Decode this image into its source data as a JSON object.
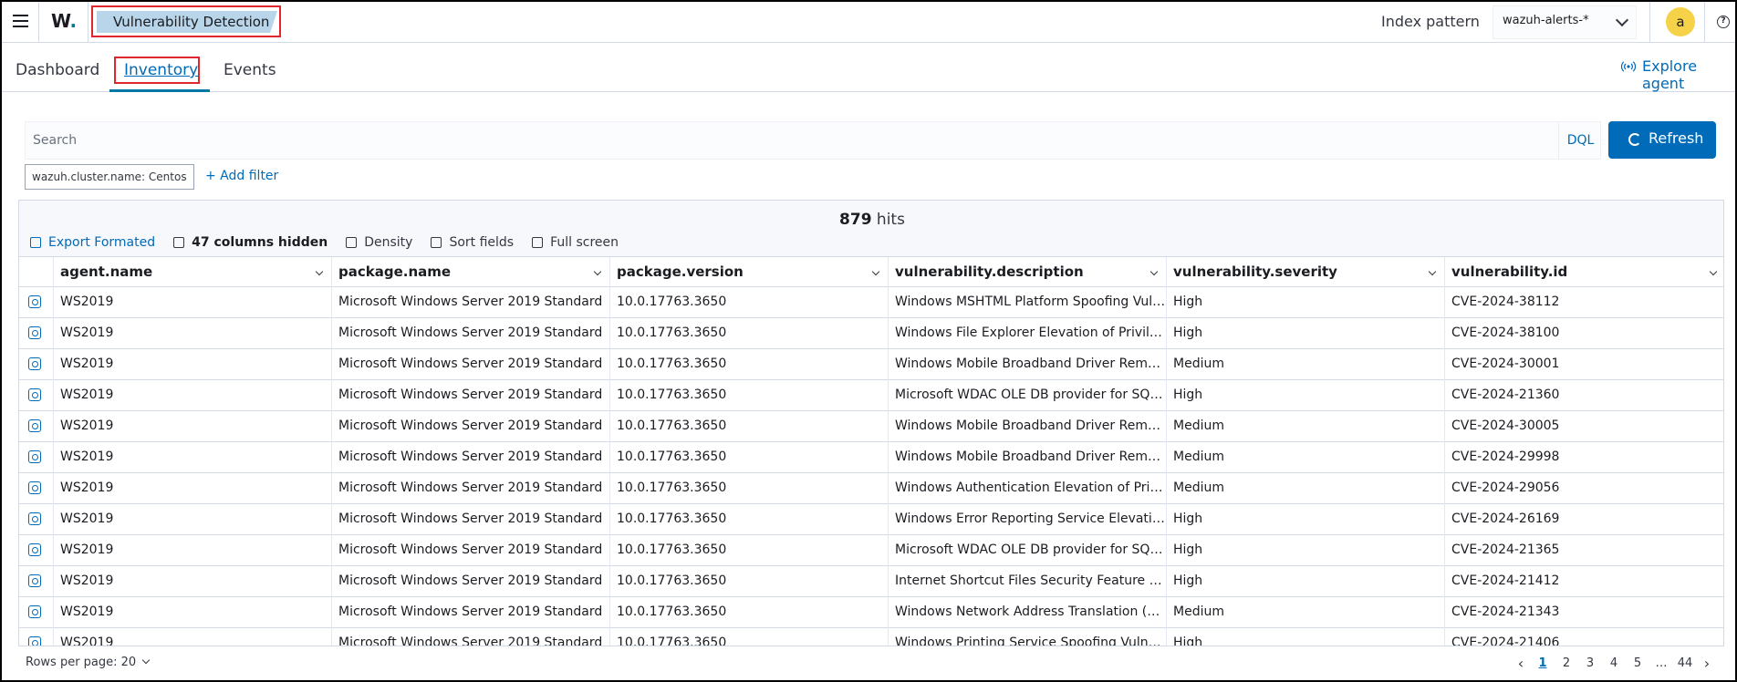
{
  "header": {
    "logo_text": "W",
    "logo_dot": ".",
    "breadcrumb": "Vulnerability Detection",
    "index_pattern_label": "Index pattern",
    "index_pattern_value": "wazuh-alerts-*",
    "avatar_initial": "a",
    "help_glyph": "?"
  },
  "tabs": [
    {
      "label": "Dashboard"
    },
    {
      "label": "Inventory"
    },
    {
      "label": "Events"
    }
  ],
  "explore_agent": "Explore agent",
  "search": {
    "placeholder": "Search",
    "query_language": "DQL",
    "refresh_label": "Refresh"
  },
  "filters": [
    {
      "label": "wazuh.cluster.name: Centos"
    }
  ],
  "add_filter_label": "+ Add filter",
  "grid": {
    "hits_count": "879",
    "hits_label": " hits",
    "toolbar": {
      "export": "Export Formated",
      "columns_hidden": "47 columns hidden",
      "density": "Density",
      "sort": "Sort fields",
      "fullscreen": "Full screen"
    },
    "columns": [
      "agent.name",
      "package.name",
      "package.version",
      "vulnerability.description",
      "vulnerability.severity",
      "vulnerability.id"
    ],
    "rows": [
      [
        "WS2019",
        "Microsoft Windows Server 2019 Standard",
        "10.0.17763.3650",
        "Windows MSHTML Platform Spoofing Vulnerability",
        "High",
        "CVE-2024-38112"
      ],
      [
        "WS2019",
        "Microsoft Windows Server 2019 Standard",
        "10.0.17763.3650",
        "Windows File Explorer Elevation of Privilege Vulnerability",
        "High",
        "CVE-2024-38100"
      ],
      [
        "WS2019",
        "Microsoft Windows Server 2019 Standard",
        "10.0.17763.3650",
        "Windows Mobile Broadband Driver Remote Code Execution",
        "Medium",
        "CVE-2024-30001"
      ],
      [
        "WS2019",
        "Microsoft Windows Server 2019 Standard",
        "10.0.17763.3650",
        "Microsoft WDAC OLE DB provider for SQL Server",
        "High",
        "CVE-2024-21360"
      ],
      [
        "WS2019",
        "Microsoft Windows Server 2019 Standard",
        "10.0.17763.3650",
        "Windows Mobile Broadband Driver Remote Code Execution",
        "Medium",
        "CVE-2024-30005"
      ],
      [
        "WS2019",
        "Microsoft Windows Server 2019 Standard",
        "10.0.17763.3650",
        "Windows Mobile Broadband Driver Remote Code Execution",
        "Medium",
        "CVE-2024-29998"
      ],
      [
        "WS2019",
        "Microsoft Windows Server 2019 Standard",
        "10.0.17763.3650",
        "Windows Authentication Elevation of Privilege",
        "Medium",
        "CVE-2024-29056"
      ],
      [
        "WS2019",
        "Microsoft Windows Server 2019 Standard",
        "10.0.17763.3650",
        "Windows Error Reporting Service Elevation",
        "High",
        "CVE-2024-26169"
      ],
      [
        "WS2019",
        "Microsoft Windows Server 2019 Standard",
        "10.0.17763.3650",
        "Microsoft WDAC OLE DB provider for SQL Server",
        "High",
        "CVE-2024-21365"
      ],
      [
        "WS2019",
        "Microsoft Windows Server 2019 Standard",
        "10.0.17763.3650",
        "Internet Shortcut Files Security Feature Bypass",
        "High",
        "CVE-2024-21412"
      ],
      [
        "WS2019",
        "Microsoft Windows Server 2019 Standard",
        "10.0.17763.3650",
        "Windows Network Address Translation (NAT)",
        "Medium",
        "CVE-2024-21343"
      ],
      [
        "WS2019",
        "Microsoft Windows Server 2019 Standard",
        "10.0.17763.3650",
        "Windows Printing Service Spoofing Vulnerability",
        "High",
        "CVE-2024-21406"
      ]
    ]
  },
  "footer": {
    "rows_per_page": "Rows per page: 20",
    "pages": [
      "1",
      "2",
      "3",
      "4",
      "5",
      "…",
      "44"
    ],
    "active_page": "1",
    "prev_glyph": "‹",
    "next_glyph": "›"
  },
  "colors": {
    "accent": "#006bb8",
    "breadcrumb_bg": "#b8d5ea",
    "highlight_border": "#e0262e",
    "avatar": "#f5d247"
  }
}
